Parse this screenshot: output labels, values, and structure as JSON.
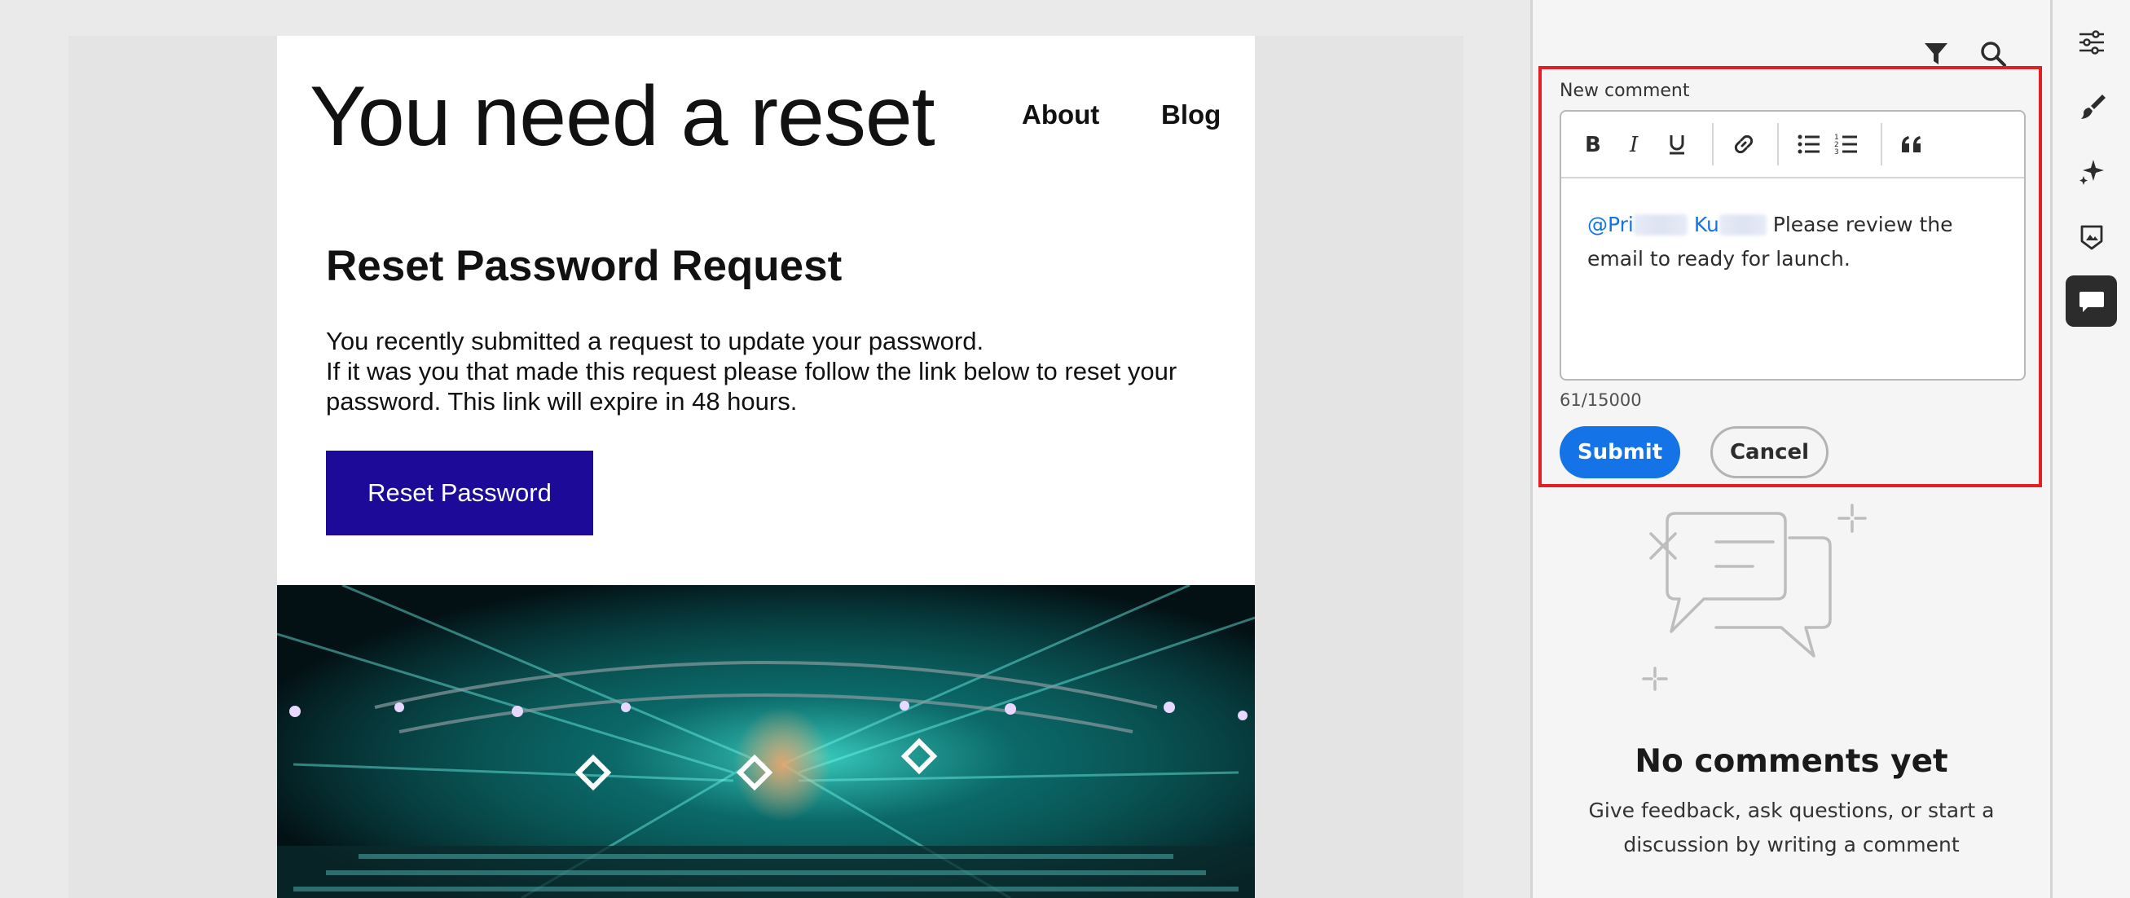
{
  "email": {
    "brand_title": "You need a reset",
    "nav": {
      "about": "About",
      "blog": "Blog"
    },
    "heading": "Reset Password Request",
    "body_line1": "You recently submitted a request to update your password.",
    "body_line2": "If it was you that made this request please follow the link below to reset your password. This link will expire in 48 hours.",
    "button_label": "Reset Password",
    "button_color": "#1e0a99"
  },
  "panel": {
    "header_icons": [
      "filter-icon",
      "search-icon"
    ],
    "new_comment_label": "New comment",
    "toolbar": [
      "bold-icon",
      "italic-icon",
      "underline-icon",
      "link-icon",
      "bulleted-list-icon",
      "numbered-list-icon",
      "quote-icon"
    ],
    "comment": {
      "mention_first": "@Pri",
      "mention_last": "Ku",
      "text": "Please review the email to ready for launch."
    },
    "char_count": "61/15000",
    "submit_label": "Submit",
    "cancel_label": "Cancel",
    "empty_title": "No comments yet",
    "empty_subtitle": "Give feedback, ask questions, or start a discussion by writing a comment",
    "accent_color": "#1473e6",
    "highlight_color": "#e31e24"
  },
  "rail": {
    "items": [
      "settings-sliders-icon",
      "brush-icon",
      "sparkle-icon",
      "image-icon",
      "comment-icon"
    ],
    "active": "comment-icon"
  }
}
